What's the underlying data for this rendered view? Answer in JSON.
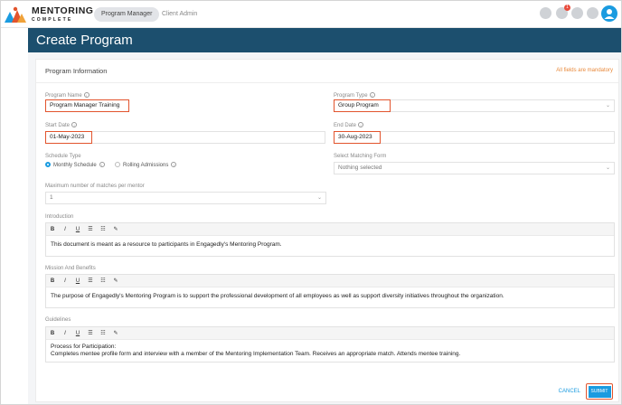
{
  "brand": {
    "line1": "MENTORING",
    "line2": "COMPLETE"
  },
  "nav": {
    "tabs": [
      {
        "label": "Program Manager"
      },
      {
        "label": "Client Admin"
      }
    ],
    "notification_count": "1"
  },
  "page": {
    "title": "Create Program"
  },
  "card": {
    "title": "Program Information",
    "mandatory_note": "All fields are mandatory"
  },
  "form": {
    "program_name": {
      "label": "Program Name",
      "value": "Program Manager Training"
    },
    "program_type": {
      "label": "Program Type",
      "value": "Group Program"
    },
    "start_date": {
      "label": "Start Date",
      "value": "01-May-2023"
    },
    "end_date": {
      "label": "End Date",
      "value": "30-Aug-2023"
    },
    "schedule_type": {
      "label": "Schedule Type",
      "options": [
        "Monthly Schedule",
        "Rolling Admissions"
      ],
      "selected": "Monthly Schedule"
    },
    "matching_form": {
      "label": "Select Matching Form",
      "value": "Nothing selected"
    },
    "max_matches": {
      "label": "Maximum number of matches per mentor",
      "value": "1"
    },
    "introduction": {
      "label": "Introduction",
      "text": "This document is meant as a resource to participants in Engagedly's Mentoring Program."
    },
    "mission": {
      "label": "Mission And Benefits",
      "text": "The purpose of Engagedly's Mentoring Program is to support the professional development of all employees as well as support diversity initiatives throughout the organization."
    },
    "guidelines": {
      "label": "Guidelines",
      "line1": "Process for Participation:",
      "line2": "Completes mentee profile form and interview with a member of the Mentoring Implementation Team. Receives an appropriate match. Attends mentee training."
    }
  },
  "toolbar": {
    "bold": "B",
    "italic": "I",
    "underline": "U",
    "bullets": "☰",
    "numbers": "☷",
    "pen": "✎"
  },
  "actions": {
    "cancel": "CANCEL",
    "submit": "SUBMIT"
  },
  "colors": {
    "accent": "#1a9be0",
    "banner": "#1c4f6e",
    "highlight": "#e2542d",
    "mandatory": "#e8893b"
  }
}
